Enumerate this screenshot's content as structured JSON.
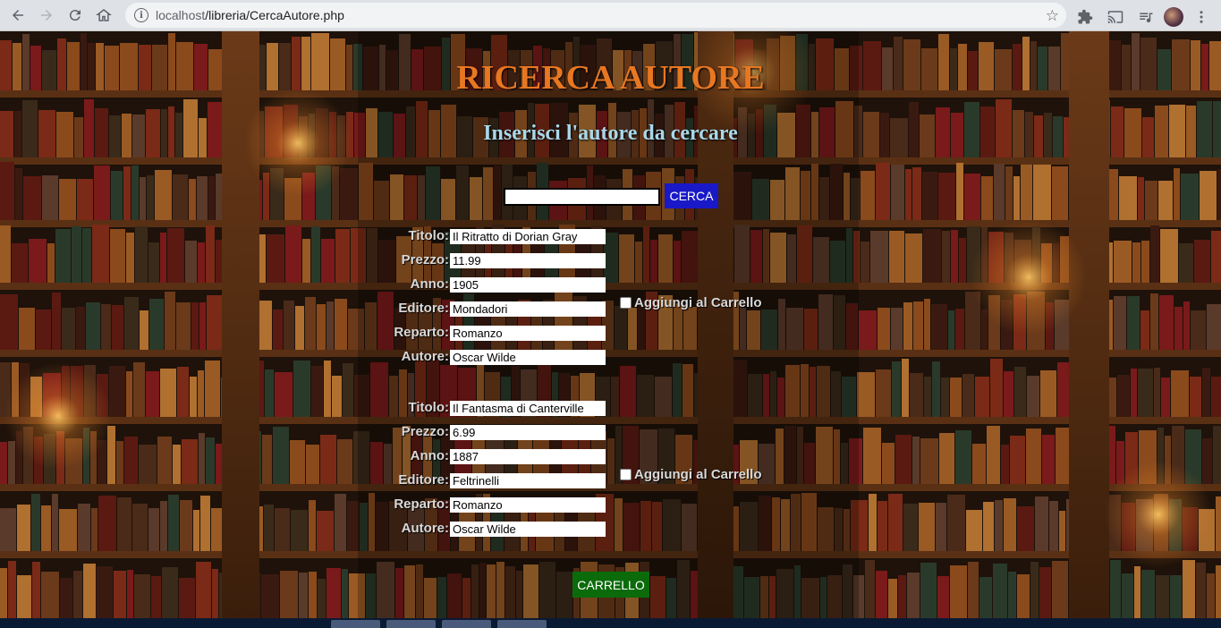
{
  "browser": {
    "url_host": "localhost",
    "url_path": "/libreria/CercaAutore.php",
    "icons": {
      "back": "arrow-left-icon",
      "forward": "arrow-right-icon",
      "reload": "reload-icon",
      "home": "home-icon",
      "info": "info-icon",
      "bookmark": "star-icon",
      "extensions": "puzzle-icon",
      "cast": "cast-icon",
      "media": "media-icon",
      "menu": "kebab-icon"
    }
  },
  "page": {
    "title": "RICERCA AUTORE",
    "subtitle": "Inserisci l'autore da cercare",
    "search": {
      "value": "",
      "button_label": "CERCA"
    },
    "labels": {
      "titolo": "Titolo:",
      "prezzo": "Prezzo:",
      "anno": "Anno:",
      "editore": "Editore:",
      "reparto": "Reparto:",
      "autore": "Autore:",
      "add_to_cart": "Aggiungi al Carrello"
    },
    "books": [
      {
        "titolo": "Il Ritratto di Dorian Gray",
        "prezzo": "11.99",
        "anno": "1905",
        "editore": "Mondadori",
        "reparto": "Romanzo",
        "autore": "Oscar Wilde"
      },
      {
        "titolo": "Il Fantasma di Canterville",
        "prezzo": "6.99",
        "anno": "1887",
        "editore": "Feltrinelli",
        "reparto": "Romanzo",
        "autore": "Oscar Wilde"
      }
    ],
    "cart_button_label": "CARRELLO"
  },
  "colors": {
    "title": "#e87722",
    "subtitle": "#a8d8ea",
    "search_button": "#1919c8",
    "cart_button": "#0b6b0b"
  }
}
